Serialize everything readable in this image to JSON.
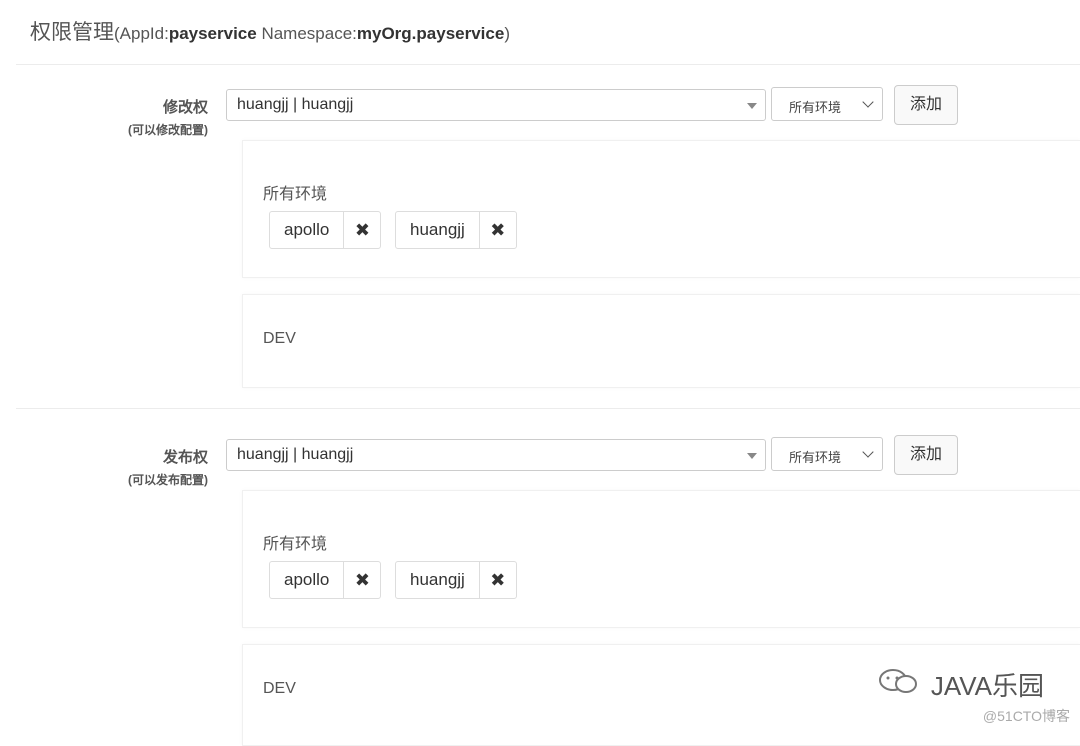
{
  "header": {
    "title": "权限管理",
    "appid_label": "(AppId:",
    "appid": "payservice",
    "namespace_label": " Namespace:",
    "namespace": "myOrg.payservice",
    "close": ")"
  },
  "modify": {
    "label": "修改权",
    "sublabel": "(可以修改配置)",
    "user_select": "huangjj | huangjj",
    "env_select": "所有环境",
    "add": "添加",
    "groups": [
      {
        "env": "所有环境",
        "users": [
          "apollo",
          "huangjj"
        ]
      },
      {
        "env": "DEV",
        "users": []
      }
    ]
  },
  "release": {
    "label": "发布权",
    "sublabel": "(可以发布配置)",
    "user_select": "huangjj | huangjj",
    "env_select": "所有环境",
    "add": "添加",
    "groups": [
      {
        "env": "所有环境",
        "users": [
          "apollo",
          "huangjj"
        ]
      },
      {
        "env": "DEV",
        "users": []
      }
    ]
  },
  "remove_icon": "✖",
  "watermark": {
    "icon": "wechat-icon",
    "text": "JAVA乐园",
    "sub": "@51CTO博客"
  }
}
